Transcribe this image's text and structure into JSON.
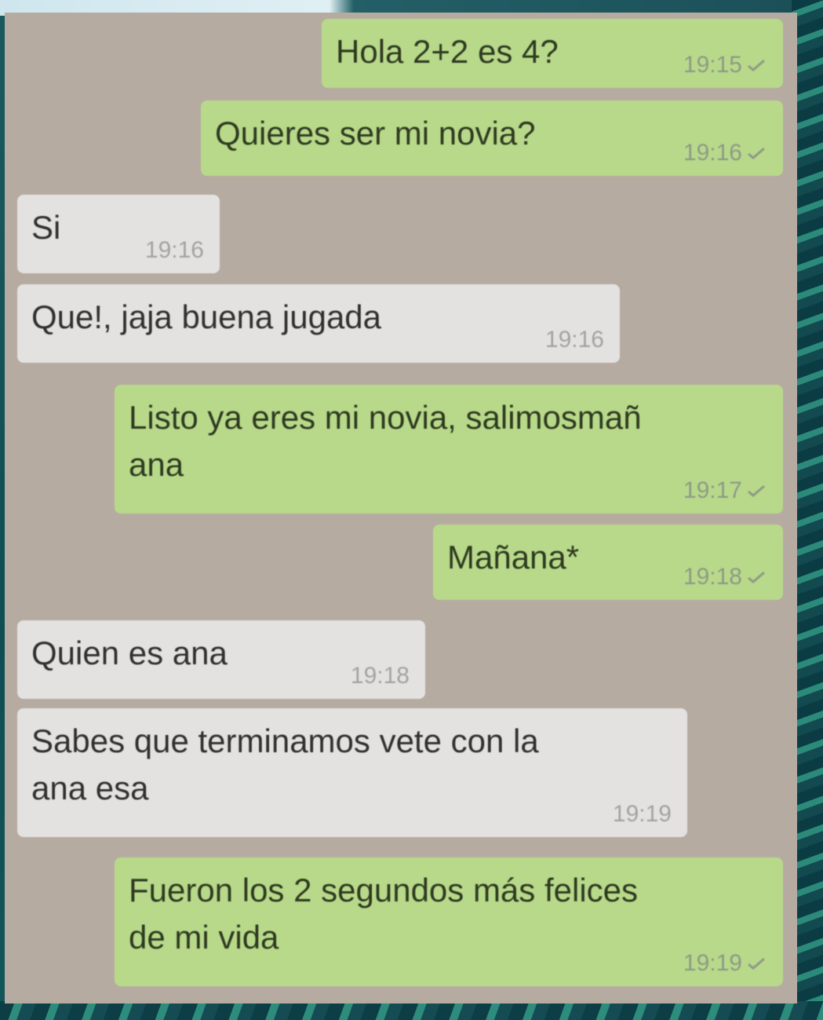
{
  "colors": {
    "outgoing_bubble": "#b8d98a",
    "incoming_bubble": "#e4e2e1",
    "chat_background": "#b6aba1"
  },
  "messages": [
    {
      "direction": "outgoing",
      "text": "Hola 2+2 es 4?",
      "time": "19:15",
      "icon": "check-icon"
    },
    {
      "direction": "outgoing",
      "text": "Quieres ser mi novia?",
      "time": "19:16",
      "icon": "check-icon"
    },
    {
      "direction": "incoming",
      "text": "Si",
      "time": "19:16"
    },
    {
      "direction": "incoming",
      "text": "Que!, jaja buena jugada",
      "time": "19:16"
    },
    {
      "direction": "outgoing",
      "text": "Listo ya eres mi novia, salimosmañ\nana",
      "time": "19:17",
      "icon": "check-icon"
    },
    {
      "direction": "outgoing",
      "text": "Mañana*",
      "time": "19:18",
      "icon": "check-icon"
    },
    {
      "direction": "incoming",
      "text": "Quien es ana",
      "time": "19:18"
    },
    {
      "direction": "incoming",
      "text": "Sabes que terminamos vete con la\nana esa",
      "time": "19:19"
    },
    {
      "direction": "outgoing",
      "text": "Fueron los 2 segundos más felices\nde mi vida",
      "time": "19:19",
      "icon": "check-icon"
    }
  ]
}
